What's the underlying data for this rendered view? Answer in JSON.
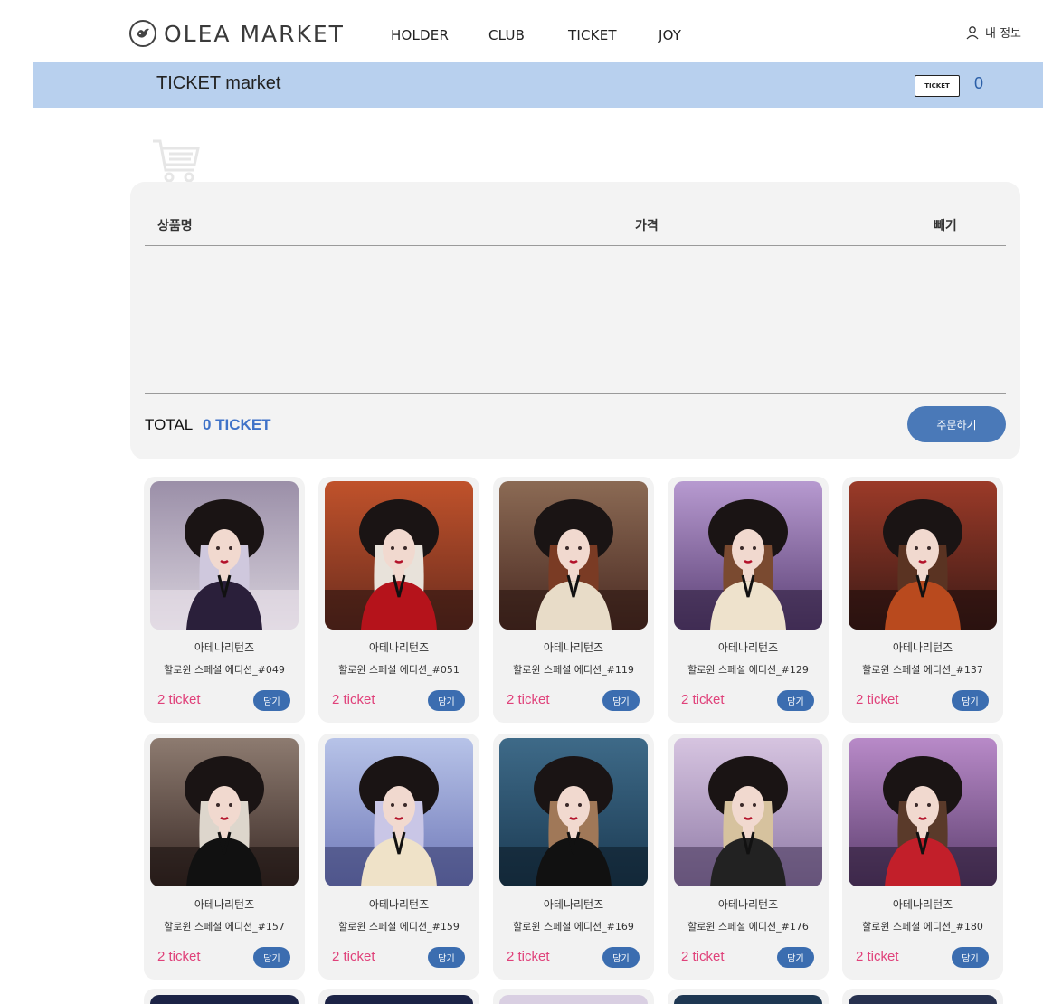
{
  "header": {
    "logo_text": "OLEA MARKET",
    "menu": [
      "HOLDER",
      "CLUB",
      "TICKET",
      "JOY"
    ],
    "my_info": "내 정보"
  },
  "band": {
    "title": "TICKET market",
    "ticket_badge": "TICKET",
    "ticket_count": "0"
  },
  "cart": {
    "col_product": "상품명",
    "col_price": "가격",
    "col_remove": "빼기",
    "total_label": "TOTAL",
    "total_value": "0 TICKET",
    "order_button": "주문하기"
  },
  "products": [
    {
      "brand": "아테나리턴즈",
      "name": "할로윈 스페셜 에디션_#049",
      "price": "2 ticket",
      "button": "담기"
    },
    {
      "brand": "아테나리턴즈",
      "name": "할로윈 스페셜 에디션_#051",
      "price": "2 ticket",
      "button": "담기"
    },
    {
      "brand": "아테나리턴즈",
      "name": "할로윈 스페셜 에디션_#119",
      "price": "2 ticket",
      "button": "담기"
    },
    {
      "brand": "아테나리턴즈",
      "name": "할로윈 스페셜 에디션_#129",
      "price": "2 ticket",
      "button": "담기"
    },
    {
      "brand": "아테나리턴즈",
      "name": "할로윈 스페셜 에디션_#137",
      "price": "2 ticket",
      "button": "담기"
    },
    {
      "brand": "아테나리턴즈",
      "name": "할로윈 스페셜 에디션_#157",
      "price": "2 ticket",
      "button": "담기"
    },
    {
      "brand": "아테나리턴즈",
      "name": "할로윈 스페셜 에디션_#159",
      "price": "2 ticket",
      "button": "담기"
    },
    {
      "brand": "아테나리턴즈",
      "name": "할로윈 스페셜 에디션_#169",
      "price": "2 ticket",
      "button": "담기"
    },
    {
      "brand": "아테나리턴즈",
      "name": "할로윈 스페셜 에디션_#176",
      "price": "2 ticket",
      "button": "담기"
    },
    {
      "brand": "아테나리턴즈",
      "name": "할로윈 스페셜 에디션_#180",
      "price": "2 ticket",
      "button": "담기"
    }
  ],
  "colors": {
    "band": "#b8d0ee",
    "accent_blue": "#3b6db0",
    "price_pink": "#e0417a",
    "total_blue": "#3f72c8"
  }
}
